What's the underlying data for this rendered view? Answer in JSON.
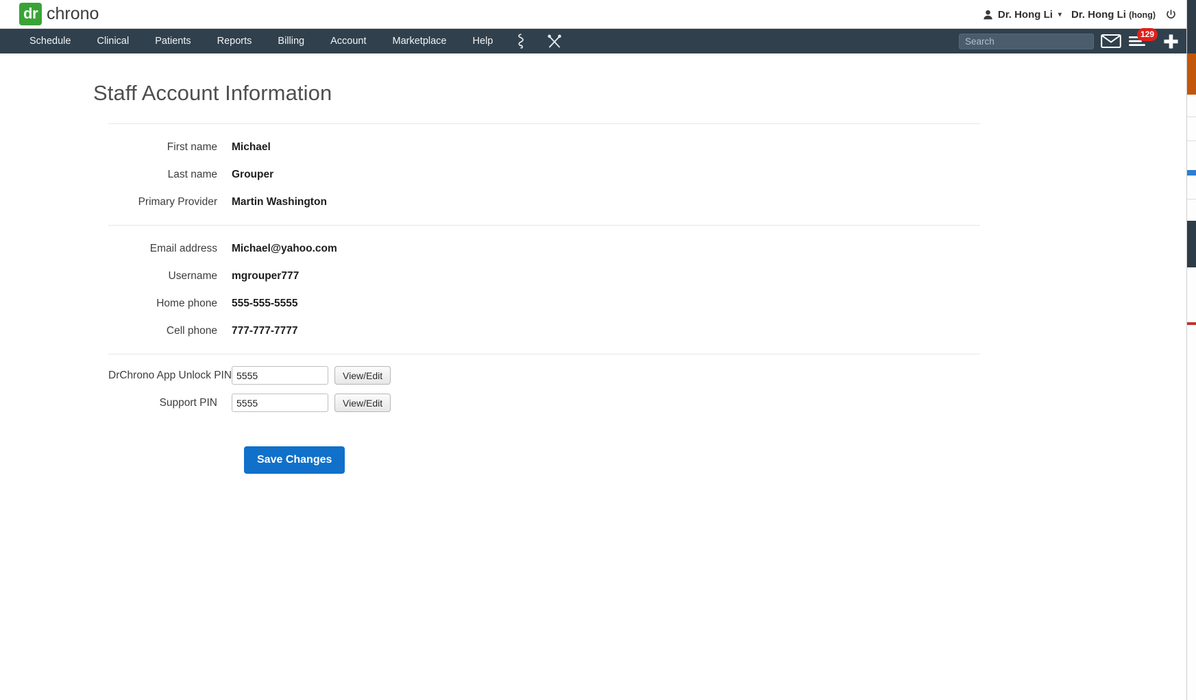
{
  "brand": {
    "logo_mark": "dr",
    "logo_word": "chrono",
    "user_menu_label": "Dr. Hong Li",
    "user_menu_caret": "▾",
    "user_display_name": "Dr. Hong Li",
    "user_handle": "(hong)",
    "person_icon": "person-icon",
    "power_icon": "power-icon"
  },
  "nav": {
    "items": [
      {
        "label": "Schedule"
      },
      {
        "label": "Clinical"
      },
      {
        "label": "Patients"
      },
      {
        "label": "Reports"
      },
      {
        "label": "Billing"
      },
      {
        "label": "Account"
      },
      {
        "label": "Marketplace"
      },
      {
        "label": "Help"
      }
    ],
    "icons": [
      {
        "name": "caduceus-icon"
      },
      {
        "name": "crossed-instruments-icon"
      }
    ],
    "search_placeholder": "Search",
    "search_value": "",
    "mail_icon": "envelope-icon",
    "menu_icon": "hamburger-icon",
    "notification_count": "129",
    "add_icon": "plus-icon",
    "accent_bar": "#30404d",
    "badge_color": "#e0201b"
  },
  "page": {
    "title": "Staff Account Information"
  },
  "identity_group": [
    {
      "label": "First name",
      "value": "Michael"
    },
    {
      "label": "Last name",
      "value": "Grouper"
    },
    {
      "label": "Primary Provider",
      "value": "Martin Washington"
    }
  ],
  "contact_group": [
    {
      "label": "Email address",
      "value": "Michael@yahoo.com"
    },
    {
      "label": "Username",
      "value": "mgrouper777"
    },
    {
      "label": "Home phone",
      "value": "555-555-5555"
    },
    {
      "label": "Cell phone",
      "value": "777-777-7777"
    }
  ],
  "pin_group": [
    {
      "label": "DrChrono App Unlock PIN",
      "value": "5555",
      "button": "View/Edit"
    },
    {
      "label": "Support PIN",
      "value": "5555",
      "button": "View/Edit"
    }
  ],
  "actions": {
    "save_label": "Save Changes",
    "save_color": "#1070ca"
  }
}
